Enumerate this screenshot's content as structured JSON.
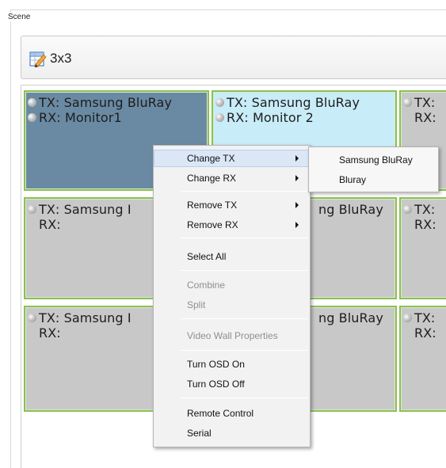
{
  "group": {
    "title": "Scene"
  },
  "header": {
    "icon": "edit-table-icon",
    "scene_name": "3x3"
  },
  "grid": {
    "cells": [
      {
        "tx": "TX: Samsung BluRay",
        "rx": "RX: Monitor1",
        "state": "selected"
      },
      {
        "tx": "TX: Samsung BluRay",
        "rx": "RX: Monitor 2",
        "state": "hover"
      },
      {
        "tx": "TX:",
        "rx": "RX:",
        "state": "normal"
      },
      {
        "tx": "TX: Samsung I",
        "rx": "RX:",
        "state": "normal"
      },
      {
        "tx": "ng BluRay",
        "rx": "",
        "state": "normal"
      },
      {
        "tx": "TX:",
        "rx": "RX:",
        "state": "normal"
      },
      {
        "tx": "TX: Samsung I",
        "rx": "RX:",
        "state": "normal"
      },
      {
        "tx": "ng BluRay",
        "rx": "",
        "state": "normal"
      },
      {
        "tx": "TX:",
        "rx": "RX:",
        "state": "normal"
      }
    ]
  },
  "context_menu": {
    "items": [
      {
        "label": "Change TX",
        "submenu": true,
        "highlighted": true
      },
      {
        "label": "Change RX",
        "submenu": true
      },
      {
        "label": "Remove TX",
        "submenu": true
      },
      {
        "label": "Remove RX",
        "submenu": true
      },
      {
        "label": "Select All"
      },
      {
        "label": "Combine",
        "disabled": true
      },
      {
        "label": "Split",
        "disabled": true
      },
      {
        "label": "Video Wall Properties",
        "disabled": true
      },
      {
        "label": "Turn OSD On"
      },
      {
        "label": "Turn OSD Off"
      },
      {
        "label": "Remote Control"
      },
      {
        "label": "Serial"
      }
    ]
  },
  "submenu": {
    "items": [
      {
        "label": "Samsung BluRay"
      },
      {
        "label": "Bluray"
      }
    ]
  }
}
